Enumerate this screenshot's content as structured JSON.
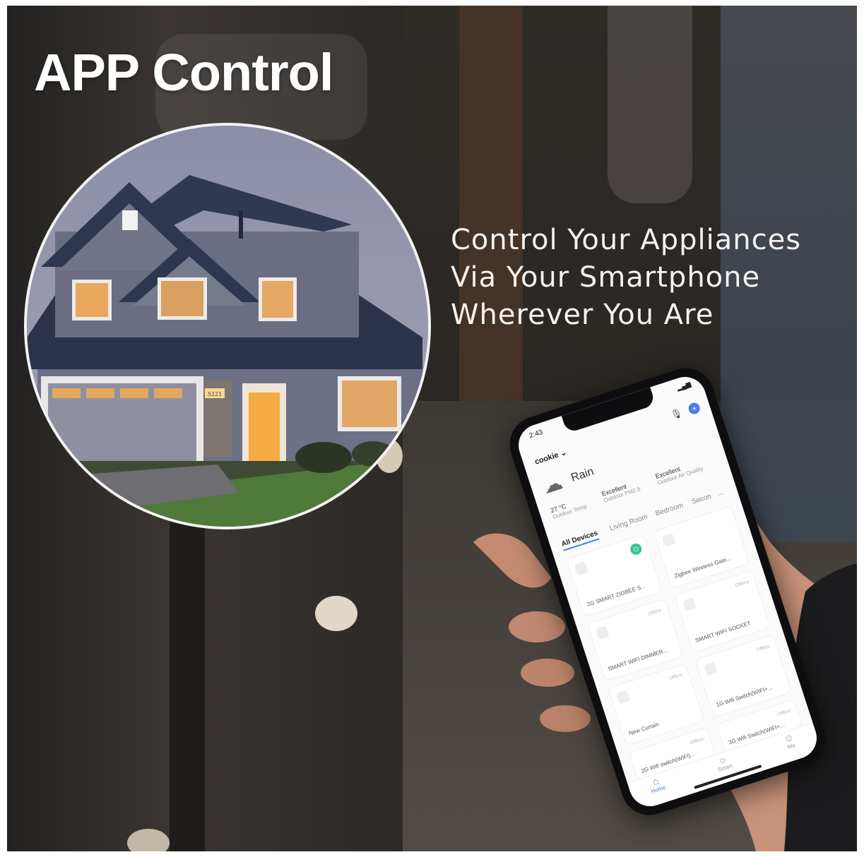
{
  "headline": "APP Control",
  "tagline": [
    "Control Your Appliances",
    "Via Your Smartphone",
    "Wherever You Are"
  ],
  "house_sign": "5221",
  "phone": {
    "time": "2:43",
    "home_name": "cookie",
    "weather": {
      "condition": "Rain",
      "temp": "27 °C",
      "temp_sub": "Outdoor Temp",
      "aq1": "Excellent",
      "aq1_sub": "Outdoor PM2.5",
      "aq2": "Excellent",
      "aq2_sub": "Outdoor Air Quality"
    },
    "tabs": [
      "All Devices",
      "Living Room",
      "Bedroom",
      "Secon",
      "..."
    ],
    "devices": [
      {
        "name": "2G SMART ZIGBEE S...",
        "status": ""
      },
      {
        "name": "Zigbee Wireless Gate...",
        "status": ""
      },
      {
        "name": "SMART WIFI DIMMER...",
        "status": "Offline"
      },
      {
        "name": "SMART WIFI SOCKET",
        "status": "Offline"
      },
      {
        "name": "New Curtain",
        "status": "Offline"
      },
      {
        "name": "1G Wifi Switch(WIFI+...",
        "status": "Offline"
      },
      {
        "name": "2G Wifi switch(WIFI)...",
        "status": "Offline"
      },
      {
        "name": "3G Wifi Switch(WIFI+...",
        "status": "Offline"
      }
    ],
    "nav": [
      "Home",
      "Smart",
      "Me"
    ]
  },
  "colors": {
    "accent": "#4b7bec",
    "toggle_on": "#38c59a",
    "window_glow": "#f6b860"
  }
}
